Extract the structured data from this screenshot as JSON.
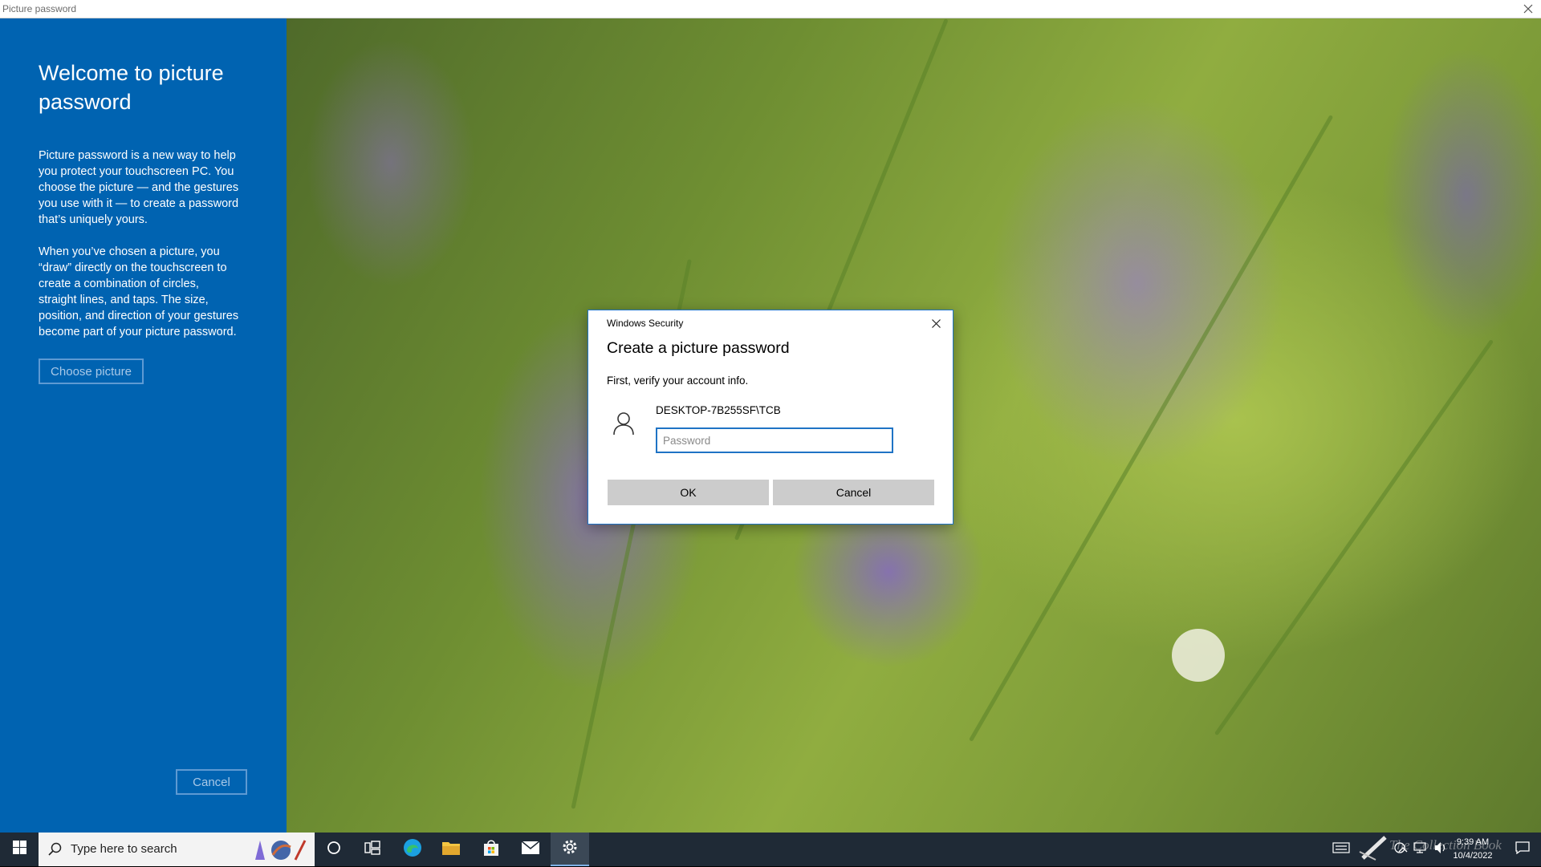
{
  "window": {
    "title": "Picture password"
  },
  "left_panel": {
    "heading": "Welcome to picture password",
    "paragraph1": "Picture password is a new way to help you protect your touchscreen PC. You choose the picture — and the gestures you use with it — to create a password that’s uniquely yours.",
    "paragraph2": "When you’ve chosen a picture, you “draw” directly on the touchscreen to create a combination of circles, straight lines, and taps. The size, position, and direction of your gestures become part of your picture password.",
    "choose_button": "Choose picture",
    "cancel_button": "Cancel",
    "background_color": "#0063b1"
  },
  "dialog": {
    "caption": "Windows Security",
    "heading": "Create a picture password",
    "instruction": "First, verify your account info.",
    "account": "DESKTOP-7B255SF\\TCB",
    "password_placeholder": "Password",
    "password_value": "",
    "ok_button": "OK",
    "cancel_button": "Cancel",
    "accent_color": "#1f73c5"
  },
  "taskbar": {
    "search_placeholder": "Type here to search",
    "apps": [
      "cortana-circle",
      "task-view",
      "edge",
      "file-explorer",
      "microsoft-store",
      "mail",
      "settings"
    ],
    "active_app": "settings",
    "clock_time": "9:39 AM",
    "clock_date": "10/4/2022",
    "watermark": "The Collection Book"
  }
}
